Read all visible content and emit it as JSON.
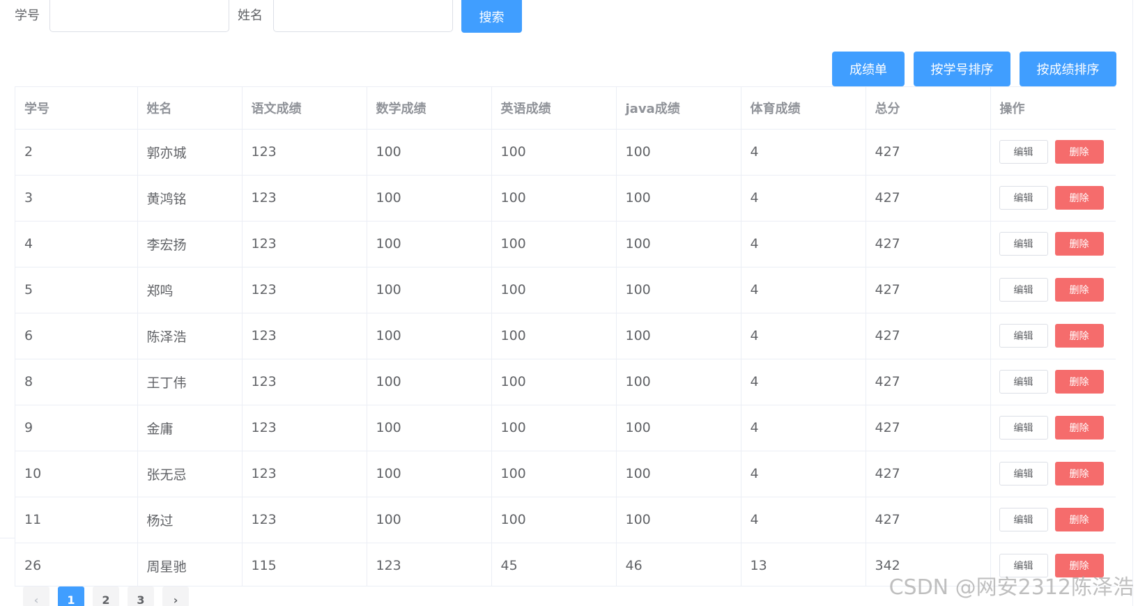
{
  "search": {
    "id_label": "学号",
    "id_value": "",
    "name_label": "姓名",
    "name_value": "",
    "search_button": "搜索"
  },
  "toolbar": {
    "report_button": "成绩单",
    "sort_by_id_button": "按学号排序",
    "sort_by_score_button": "按成绩排序"
  },
  "table": {
    "columns": [
      "学号",
      "姓名",
      "语文成绩",
      "数学成绩",
      "英语成绩",
      "java成绩",
      "体育成绩",
      "总分",
      "操作"
    ],
    "edit_label": "编辑",
    "delete_label": "删除",
    "rows": [
      [
        "2",
        "郭亦城",
        "123",
        "100",
        "100",
        "100",
        "4",
        "427"
      ],
      [
        "3",
        "黄鸿铭",
        "123",
        "100",
        "100",
        "100",
        "4",
        "427"
      ],
      [
        "4",
        "李宏扬",
        "123",
        "100",
        "100",
        "100",
        "4",
        "427"
      ],
      [
        "5",
        "郑鸣",
        "123",
        "100",
        "100",
        "100",
        "4",
        "427"
      ],
      [
        "6",
        "陈泽浩",
        "123",
        "100",
        "100",
        "100",
        "4",
        "427"
      ],
      [
        "8",
        "王丁伟",
        "123",
        "100",
        "100",
        "100",
        "4",
        "427"
      ],
      [
        "9",
        "金庸",
        "123",
        "100",
        "100",
        "100",
        "4",
        "427"
      ],
      [
        "10",
        "张无忌",
        "123",
        "100",
        "100",
        "100",
        "4",
        "427"
      ],
      [
        "11",
        "杨过",
        "123",
        "100",
        "100",
        "100",
        "4",
        "427"
      ],
      [
        "26",
        "周星驰",
        "115",
        "123",
        "45",
        "46",
        "13",
        "342"
      ]
    ]
  },
  "pagination": {
    "prev": "‹",
    "pages": [
      "1",
      "2",
      "3"
    ],
    "current": "1",
    "next": "›"
  },
  "watermark": "CSDN @网安2312陈泽浩",
  "colors": {
    "primary": "#409eff",
    "danger": "#f56c6c",
    "border": "#ebeef5"
  }
}
